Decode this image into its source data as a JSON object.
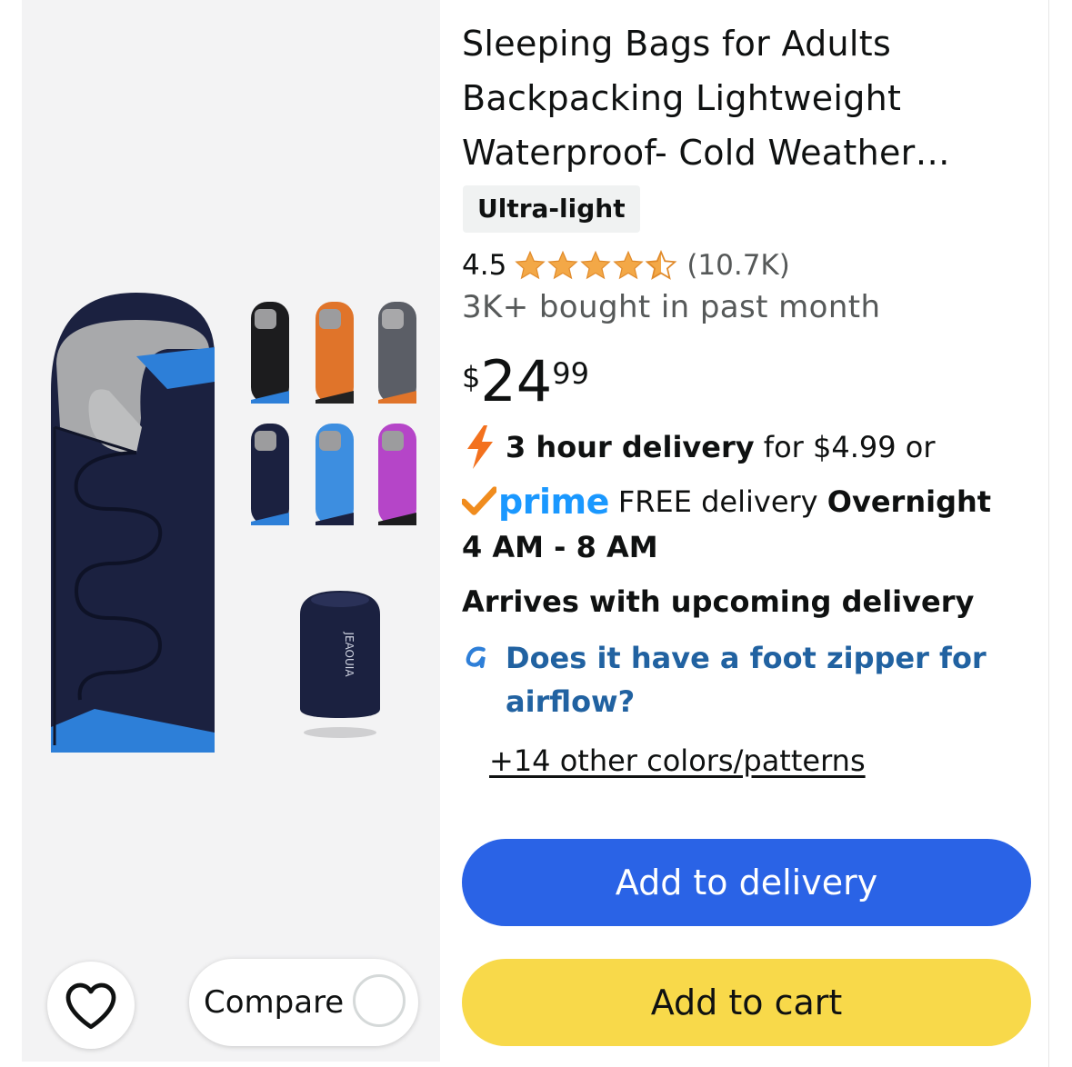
{
  "product": {
    "title": "Sleeping Bags for Adults Backpacking Lightweight Waterproof- Cold Weather…",
    "badge": "Ultra-light",
    "rating": "4.5",
    "rating_count": "(10.7K)",
    "stars": 4.5,
    "bought": "3K+ bought in past month",
    "price": {
      "symbol": "$",
      "whole": "24",
      "fraction": "99"
    },
    "image_brand": "JEAOUIA"
  },
  "delivery": {
    "fast_bold": "3 hour delivery",
    "fast_rest": " for $4.99 or",
    "prime_word": "prime",
    "prime_text": "FREE delivery ",
    "prime_bold": "Overnight",
    "time_window": "4 AM - 8 AM",
    "arrives": "Arrives with upcoming delivery"
  },
  "question": "Does it have a foot zipper for airflow?",
  "colors_link": "+14 other colors/patterns",
  "buttons": {
    "add_to_delivery": "Add to delivery",
    "add_to_cart": "Add to cart",
    "compare": "Compare"
  },
  "colors": {
    "star": "#f3a847",
    "prime_blue": "#1a98ff",
    "prime_check": "#f08c1e",
    "link": "#2162a1",
    "delivery_button": "#2a63e6",
    "cart_button": "#f8d94a"
  },
  "icons": [
    "heart-icon",
    "lightning-icon",
    "prime-check-icon",
    "rufus-question-icon",
    "star-icon"
  ]
}
